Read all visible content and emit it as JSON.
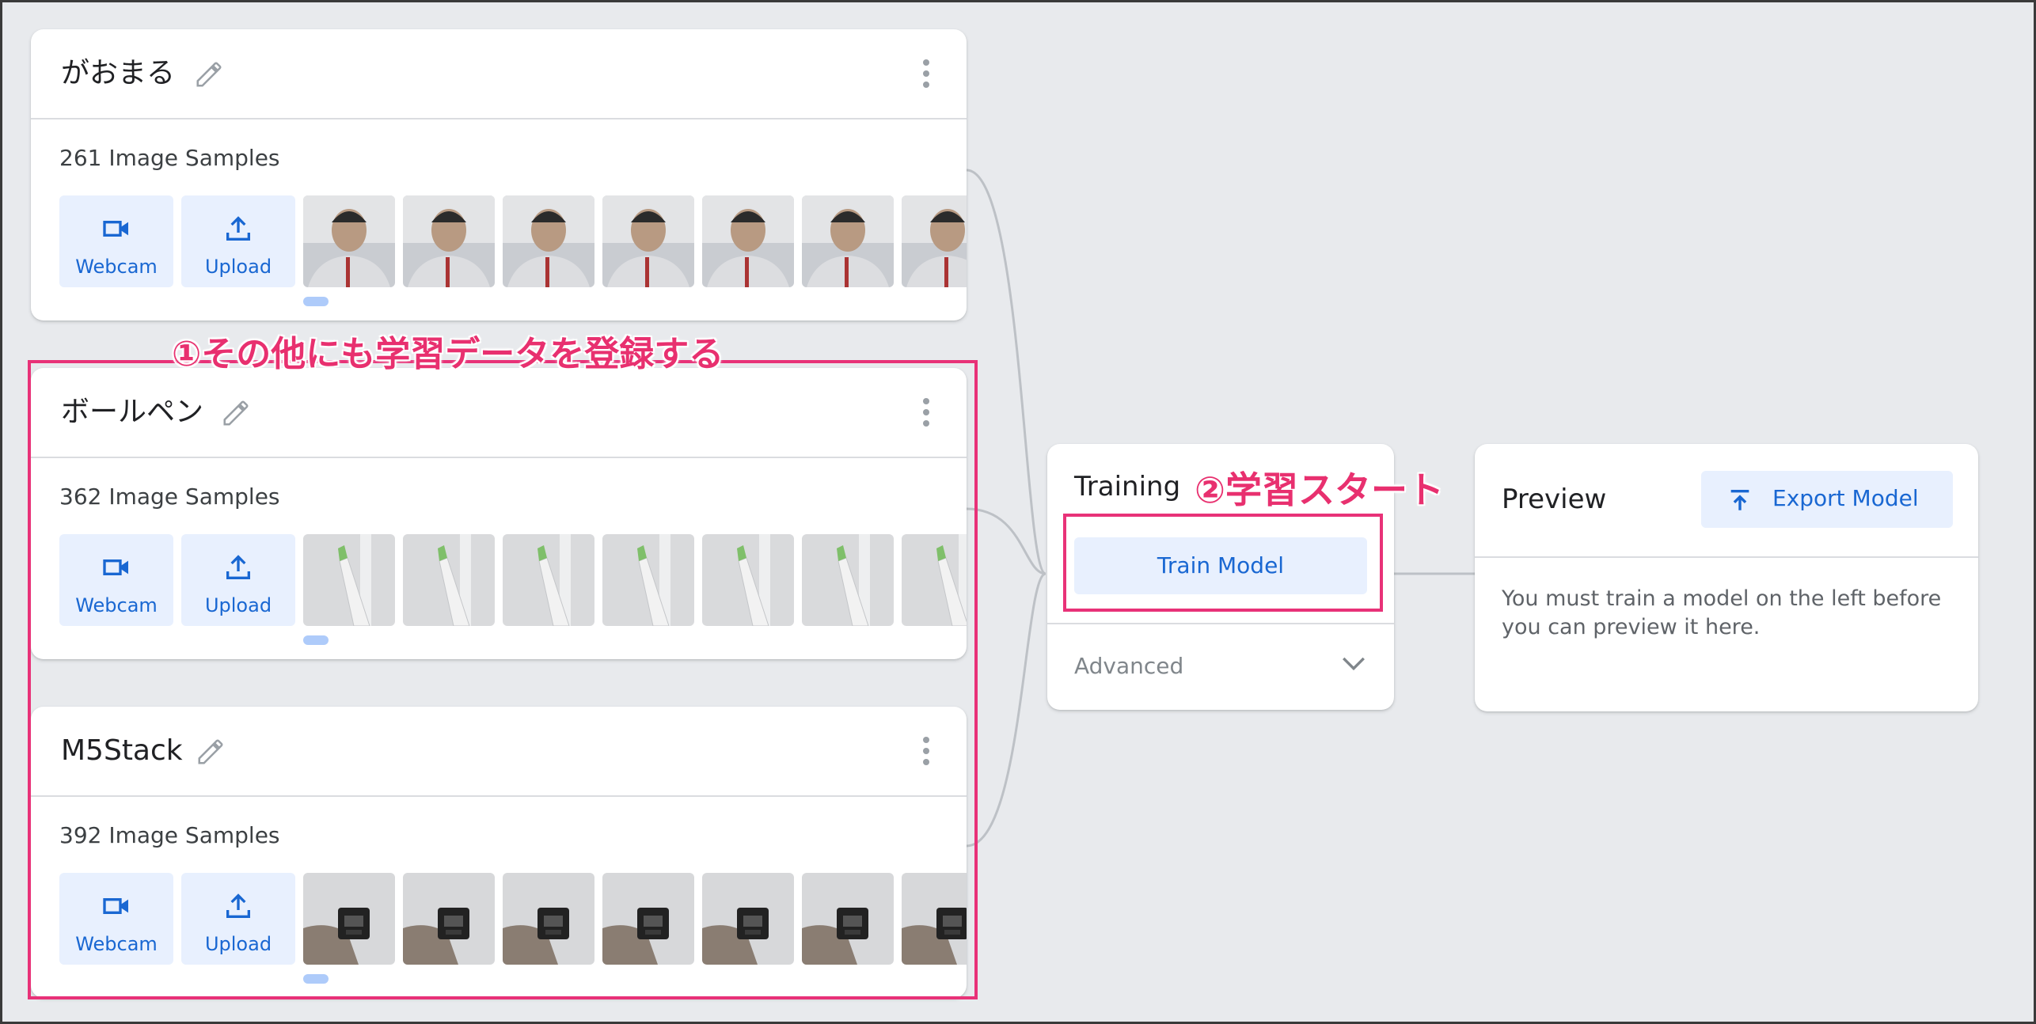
{
  "classes": [
    {
      "name": "がおまる",
      "samples_label": "261 Image Samples",
      "thumb_kind": "person"
    },
    {
      "name": "ボールペン",
      "samples_label": "362 Image Samples",
      "thumb_kind": "pen"
    },
    {
      "name": "M5Stack",
      "samples_label": "392 Image Samples",
      "thumb_kind": "device"
    }
  ],
  "sample_sources": {
    "webcam_label": "Webcam",
    "upload_label": "Upload"
  },
  "annotations": {
    "step1": "①その他にも学習データを登録する",
    "step2": "②学習スタート"
  },
  "training": {
    "title": "Training",
    "train_button_label": "Train Model",
    "advanced_label": "Advanced"
  },
  "preview": {
    "title": "Preview",
    "export_button_label": "Export Model",
    "message": "You must train a model on the left before you can preview it here."
  },
  "colors": {
    "accent": "#1967d2",
    "accent_bg": "#e8f0fe",
    "annotation_pink": "#e8306f",
    "background": "#e8eaed"
  },
  "icons": [
    "pencil-icon",
    "more-vert-icon",
    "videocam-icon",
    "upload-icon",
    "chevron-down-icon",
    "export-icon"
  ]
}
